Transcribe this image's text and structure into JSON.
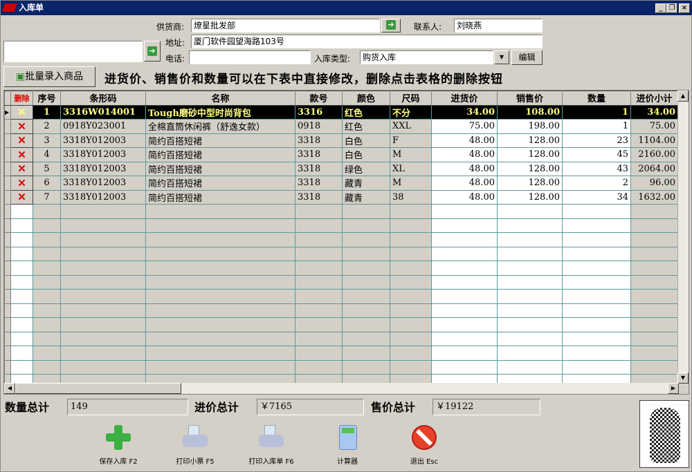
{
  "window": {
    "title": "入库单",
    "minimize": "_",
    "restore": "❐",
    "close": "×"
  },
  "form": {
    "supplier_label": "供货商:",
    "supplier_value": "燎星批发部",
    "contact_label": "联系人:",
    "contact_value": "刘晓燕",
    "address_label": "地址:",
    "address_value": "厦门软件园望海路103号",
    "phone_label": "电话:",
    "phone_value": "",
    "type_label": "入库类型:",
    "type_value": "购货入库",
    "edit_button": "编辑",
    "barcode_value": ""
  },
  "batch_button": "批量录入商品",
  "hint": "进货价、销售价和数量可以在下表中直接修改，删除点击表格的删除按钮",
  "table": {
    "headers": [
      "删除",
      "序号",
      "条形码",
      "名称",
      "款号",
      "颜色",
      "尺码",
      "进货价",
      "销售价",
      "数量",
      "进价小计"
    ],
    "rows": [
      [
        "1",
        "3316W014001",
        "Tough磨砂中型时尚背包",
        "3316",
        "红色",
        "不分",
        "34.00",
        "108.00",
        "1",
        "34.00"
      ],
      [
        "2",
        "0918Y023001",
        "全棉直筒休闲裤（舒逸女款）",
        "0918",
        "红色",
        "XXL",
        "75.00",
        "198.00",
        "1",
        "75.00"
      ],
      [
        "3",
        "3318Y012003",
        "简约百搭短裙",
        "3318",
        "白色",
        "F",
        "48.00",
        "128.00",
        "23",
        "1104.00"
      ],
      [
        "4",
        "3318Y012003",
        "简约百搭短裙",
        "3318",
        "白色",
        "M",
        "48.00",
        "128.00",
        "45",
        "2160.00"
      ],
      [
        "5",
        "3318Y012003",
        "简约百搭短裙",
        "3318",
        "绿色",
        "XL",
        "48.00",
        "128.00",
        "43",
        "2064.00"
      ],
      [
        "6",
        "3318Y012003",
        "简约百搭短裙",
        "3318",
        "藏青",
        "M",
        "48.00",
        "128.00",
        "2",
        "96.00"
      ],
      [
        "7",
        "3318Y012003",
        "简约百搭短裙",
        "3318",
        "藏青",
        "38",
        "48.00",
        "128.00",
        "34",
        "1632.00"
      ]
    ],
    "selected_row": 0
  },
  "totals": {
    "qty_label": "数量总计",
    "qty_value": "149",
    "cost_label": "进价总计",
    "cost_value": "￥7165",
    "sale_label": "售价总计",
    "sale_value": "￥19122"
  },
  "toolbar": [
    {
      "label": "保存入库 F2",
      "icon": "plus-icon"
    },
    {
      "label": "打印小票 F5",
      "icon": "printer-icon"
    },
    {
      "label": "打印入库单 F6",
      "icon": "printer-icon"
    },
    {
      "label": "计算器",
      "icon": "calculator-icon"
    },
    {
      "label": "退出 Esc",
      "icon": "stop-icon"
    }
  ]
}
